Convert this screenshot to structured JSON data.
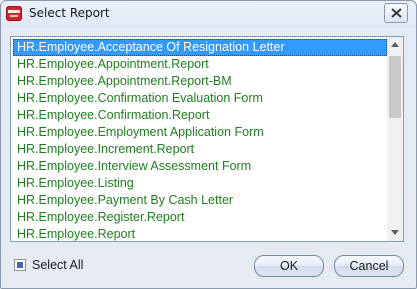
{
  "window": {
    "title": "Select Report",
    "icon": "app-logo-icon"
  },
  "list": {
    "items": [
      "HR.Employee.Acceptance Of Resignation Letter",
      "HR.Employee.Appointment.Report",
      "HR.Employee.Appointment.Report-BM",
      "HR.Employee.Confirmation Evaluation Form",
      "HR.Employee.Confirmation.Report",
      "HR.Employee.Employment Application Form",
      "HR.Employee.Increment.Report",
      "HR.Employee.Interview Assessment Form",
      "HR.Employee.Listing",
      "HR.Employee.Payment By Cash Letter",
      "HR.Employee.Register.Report",
      "HR.Employee.Report"
    ],
    "selected_index": 0,
    "item_color": "#1f7f1f",
    "selected_bg": "#3399ff"
  },
  "footer": {
    "select_all_label": "Select All",
    "select_all_state": "indeterminate",
    "ok_label": "OK",
    "cancel_label": "Cancel"
  }
}
